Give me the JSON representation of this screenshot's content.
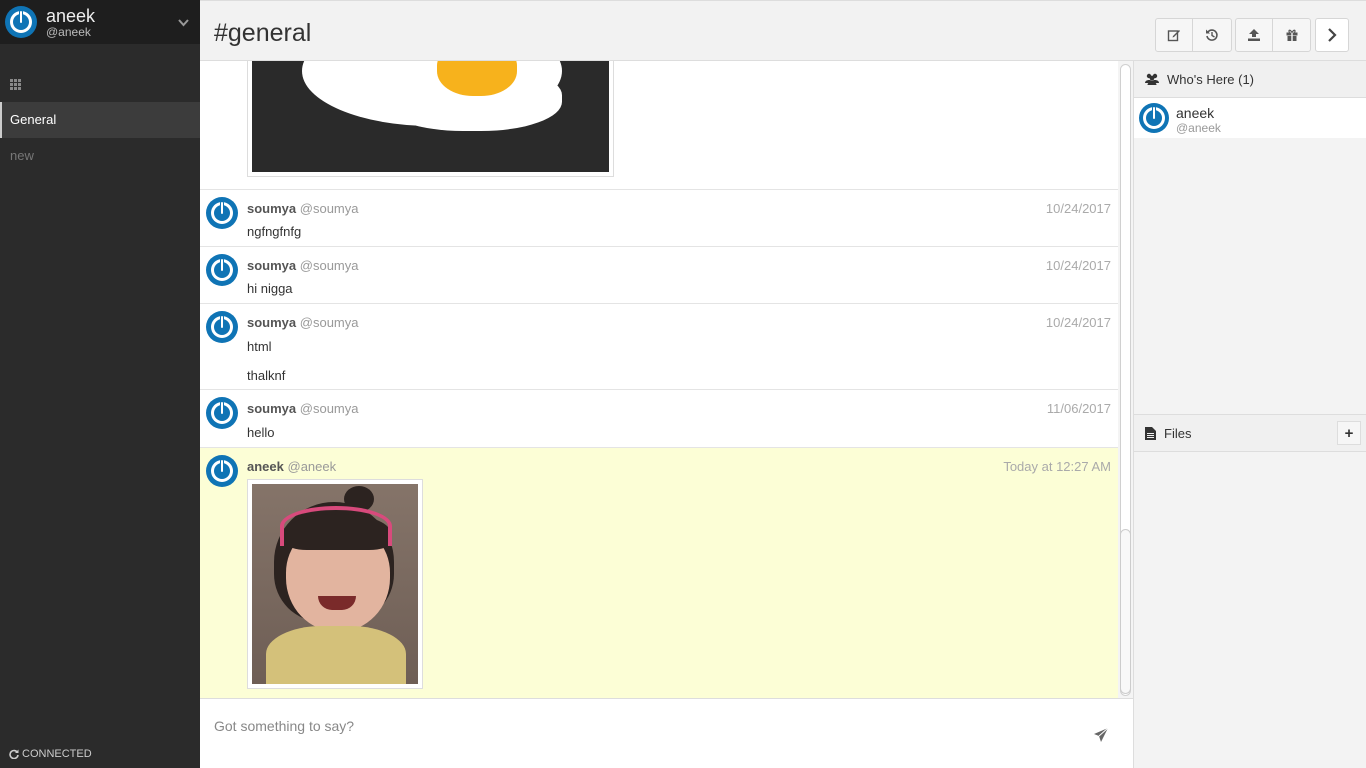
{
  "user": {
    "name": "aneek",
    "handle": "@aneek"
  },
  "sidebar": {
    "rooms": [
      {
        "label": "General",
        "active": true
      },
      {
        "label": "new",
        "active": false
      }
    ],
    "status": "CONNECTED"
  },
  "header": {
    "title": "#general",
    "buttons": [
      "edit-icon",
      "history-icon",
      "upload-icon",
      "gift-icon",
      "chevron-right-icon"
    ]
  },
  "messages": [
    {
      "author": "soumya",
      "handle": "@soumya",
      "time": "10/24/2017",
      "text": [
        "ngfngfnfg"
      ]
    },
    {
      "author": "soumya",
      "handle": "@soumya",
      "time": "10/24/2017",
      "text": [
        "hi nigga"
      ]
    },
    {
      "author": "soumya",
      "handle": "@soumya",
      "time": "10/24/2017",
      "text": [
        "html",
        "thalknf"
      ]
    },
    {
      "author": "soumya",
      "handle": "@soumya",
      "time": "11/06/2017",
      "text": [
        "hello"
      ]
    },
    {
      "author": "aneek",
      "handle": "@aneek",
      "time": "Today at 12:27 AM",
      "text": [],
      "highlighted": true
    }
  ],
  "composer": {
    "placeholder": "Got something to say?"
  },
  "right_panel": {
    "who_title": "Who's Here (1)",
    "who_users": [
      {
        "name": "aneek",
        "handle": "@aneek"
      }
    ],
    "files_title": "Files",
    "files_add": "+"
  },
  "colors": {
    "accent": "#0f74b5",
    "highlight": "#fcfed6",
    "sidebar": "#2b2b2b"
  }
}
